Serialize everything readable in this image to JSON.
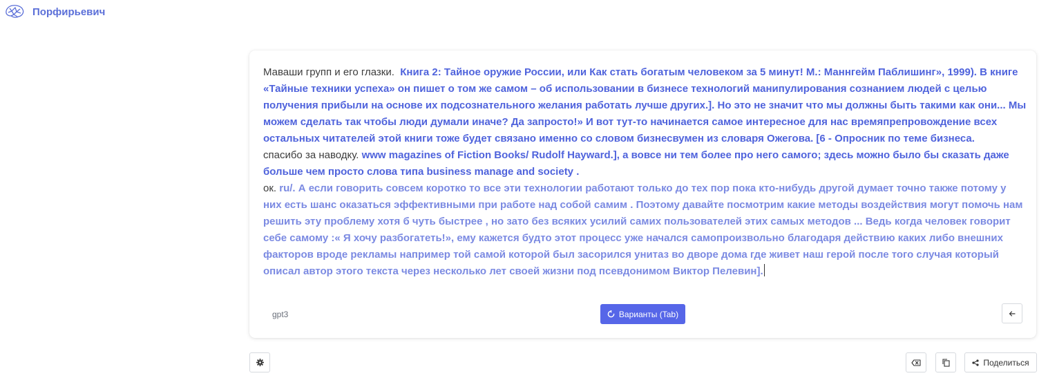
{
  "app": {
    "title": "Порфирьевич",
    "brand_color": "#5b6fd8"
  },
  "editor": {
    "segments": [
      {
        "prompt": "Маваши групп и его глазки.",
        "generated": "Книга 2: Тайное оружие России, или Как стать богатым человеком за 5 минут! М.: Маннгейм Паблишинг», 1999). В книге «Тайные техники успеха» он пишет о том же самом – об использовании в бизнесе технологий манипулирования сознанием людей с целью получения прибыли на основе их подсознательного желания работать лучше других.]. Но это не значит что мы должны быть такими как они... Мы можем сделать так чтобы люди думали иначе? Да запросто!» И вот тут-то начинается самое интересное для нас времяпрепровождение всех остальных читателей этой книги тоже будет связано именно со словом бизнесвумен из словаря Ожегова. [6 - Опросник по теме бизнеса."
      },
      {
        "prompt": "спасибо за наводку.",
        "generated": "www magazines of Fiction Books/ Rudolf Hayward.], а вовсе ни тем более про него самого; здесь можно было бы сказать даже больше чем просто слова типа business manage and society ."
      },
      {
        "prompt": "ок.",
        "generated": "ru/. А если говорить совсем коротко то все эти технологии работают только до тех пор пока кто-нибудь другой думает точно также потому у них есть шанс оказаться эффективными при работе над собой самим . Поэтому давайте посмотрим какие методы воздействия могут помочь нам решить эту проблему хотя б чуть быстрее , но зато без всяких усилий самих пользователей этих самых методов ... Ведь когда человек говорит себе самому :« Я хочу разбогатеть!», ему кажется будто этот процесс уже начался самопроизвольно благодаря действию каких либо внешних факторов вроде рекламы например той самой которой был засорился унитаз во дворе дома где живет наш герой после того случая который описал автор этого текста через несколько лет своей жизни под псевдонимом Виктор Пелевин]."
      }
    ],
    "model": "gpt3",
    "variants_label": "Варианты (Tab)"
  },
  "footer": {
    "share_label": "Поделиться"
  },
  "colors": {
    "accent": "#5666e8",
    "generated_primary": "#4f63dc",
    "generated_secondary": "#7b8ae2"
  },
  "icons": {
    "logo": "brain-icon",
    "variants": "refresh-icon",
    "back": "arrow-left-icon",
    "settings": "gear-icon",
    "clear": "backspace-icon",
    "copy": "copy-icon",
    "share": "share-icon"
  }
}
